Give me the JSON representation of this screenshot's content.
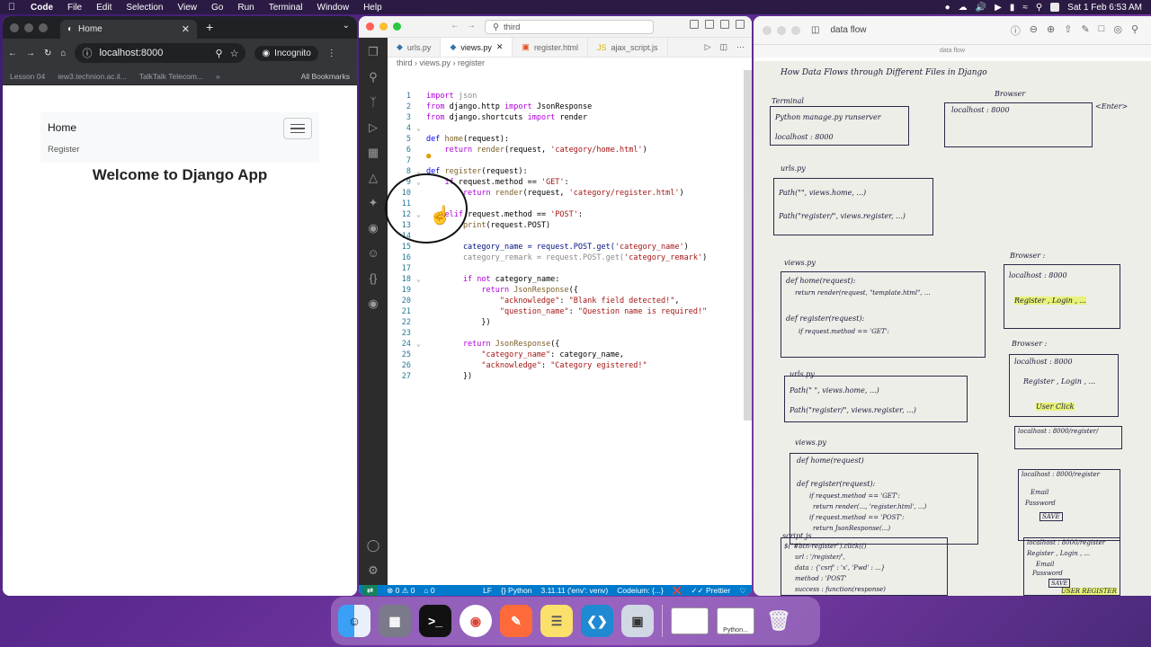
{
  "menubar": {
    "app": "Code",
    "items": [
      "File",
      "Edit",
      "Selection",
      "View",
      "Go",
      "Run",
      "Terminal",
      "Window",
      "Help"
    ],
    "datetime": "Sat 1 Feb  6:53 AM"
  },
  "chrome": {
    "tab_title": "Home",
    "url": "localhost:8000",
    "incognito_label": "Incognito",
    "bookmarks": [
      "Lesson 04",
      "iew3.technion.ac.il...",
      "TalkTalk Telecom..."
    ],
    "all_bookmarks": "All Bookmarks",
    "page": {
      "brand": "Home",
      "nav_link": "Register",
      "heading": "Welcome to Django App"
    }
  },
  "vscode": {
    "search": "third",
    "tabs": [
      {
        "label": "urls.py"
      },
      {
        "label": "views.py"
      },
      {
        "label": "register.html"
      },
      {
        "label": "ajax_script.js"
      }
    ],
    "breadcrumbs": [
      "third",
      "views.py",
      "register"
    ],
    "lines": [
      "1",
      "2",
      "3",
      "4",
      "5",
      "6",
      "7",
      "8",
      "9",
      "10",
      "11",
      "12",
      "13",
      "14",
      "15",
      "16",
      "17",
      "18",
      "19",
      "20",
      "21",
      "22",
      "23",
      "24",
      "25",
      "26",
      "27"
    ],
    "code": {
      "l1a": "import",
      "l1b": " json",
      "l2a": "from",
      "l2b": " django.http ",
      "l2c": "import",
      "l2d": " JsonResponse",
      "l3a": "from",
      "l3b": " django.shortcuts ",
      "l3c": "import",
      "l3d": " render",
      "l5a": "def",
      "l5b": " home",
      "l5c": "(request):",
      "l6a": "    return",
      "l6b": " render",
      "l6c": "(request, ",
      "l6d": "'category/home.html'",
      "l6e": ")",
      "l8a": "def",
      "l8b": " register",
      "l8c": "(request):",
      "l9a": "    if",
      "l9b": " request.method == ",
      "l9c": "'GET'",
      "l9d": ":",
      "l10a": "        return",
      "l10b": " render",
      "l10c": "(request, ",
      "l10d": "'category/register.html'",
      "l10e": ")",
      "l12a": "    elif",
      "l12b": " request.method == ",
      "l12c": "'POST'",
      "l12d": ":",
      "l13a": "        print",
      "l13b": "(request.POST)",
      "l15a": "        category_name = request.POST.get(",
      "l15b": "'category_name'",
      "l15c": ")",
      "l16a": "        category_remark = request.POST.get(",
      "l16b": "'category_remark'",
      "l16c": ")",
      "l18a": "        if not",
      "l18b": " category_name:",
      "l19a": "            return",
      "l19b": " JsonResponse",
      "l19c": "({",
      "l20a": "                \"acknowledge\"",
      "l20b": ": ",
      "l20c": "\"Blank field detected!\"",
      "l20d": ",",
      "l21a": "                \"question_name\"",
      "l21b": ": ",
      "l21c": "\"Question name is required!\"",
      "l22": "            })",
      "l24a": "        return",
      "l24b": " JsonResponse",
      "l24c": "({",
      "l25a": "            \"category_name\"",
      "l25b": ": category_name,",
      "l26a": "            \"acknowledge\"",
      "l26b": ": ",
      "l26c": "\"Category egistered!\"",
      "l27": "        })"
    },
    "status": {
      "errors": "0",
      "warnings": "0",
      "ports": "0",
      "eol": "LF",
      "language": "Python",
      "interpreter": "3.11.11 ('env': venv)",
      "codeium": "Codeium: {...}",
      "prettier": "Prettier"
    }
  },
  "preview": {
    "title": "data flow",
    "subtitle": "data flow",
    "notes": {
      "heading": "How Data Flows through Different Files in Django",
      "terminal": "Terminal",
      "runserver": "Python manage.py runserver",
      "localhost8000a": "localhost : 8000",
      "browser1": "Browser",
      "localhost8000b": "localhost : 8000",
      "enter": "<Enter>",
      "urls1": "urls.py",
      "path1": "Path(\"\", views.home, ...)",
      "path2": "Path(\"register/\", views.register, ...)",
      "views1": "views.py",
      "def_home": "def home(request):",
      "ret_render": "return render(request, \"template.html\", ...",
      "def_reg": "def register(request):",
      "if_get": "if request.method == 'GET':",
      "browser2": "Browser :",
      "localhost8000c": "localhost : 8000",
      "reg_login": "Register , Login , ...",
      "browser3": "Browser :",
      "localhost8000d": "localhost : 8000",
      "reg_login2": "Register , Login , ...",
      "user_click": "User Click",
      "urls2": "urls.py",
      "path3": "Path(\" \", views.home, ...)",
      "path4": "Path(\"register/\", views.register, ...)",
      "lh_register": "localhost : 8000/register/",
      "views2": "views.py",
      "def_home2": "def home(request)",
      "def_reg2": "def register(request):",
      "if_get2": "if request.method == 'GET':",
      "ret_render2": "return render(..., 'register.html', ...)",
      "elif_post": "if request.method == 'POST':",
      "ret_json": "return JsonResponse(...)",
      "lh_register2": "localhost : 8000/register",
      "email": "Email",
      "password": "Password",
      "save": "SAVE",
      "script": "script.js",
      "btn_click": "$(\"#btn-register\").click(()",
      "url_reg": "url : '/register/',",
      "data_reg": "data : {'csrf' : 'x', 'Pwd' : ...}",
      "method_post": "method : 'POST'",
      "success": "success : function(response)",
      "lh_register3": "localhost : 8000/register",
      "reg_login3": "Register , Login , ...",
      "email2": "Email",
      "password2": "Password",
      "save2": "SAVE",
      "user_register": "USER REGISTER"
    }
  },
  "dock": {
    "apps": [
      "Finder",
      "Launchpad",
      "Terminal",
      "Chrome",
      "Kolourpaint",
      "Notes",
      "VS Code",
      "Preview"
    ],
    "python_label": "Python..."
  }
}
